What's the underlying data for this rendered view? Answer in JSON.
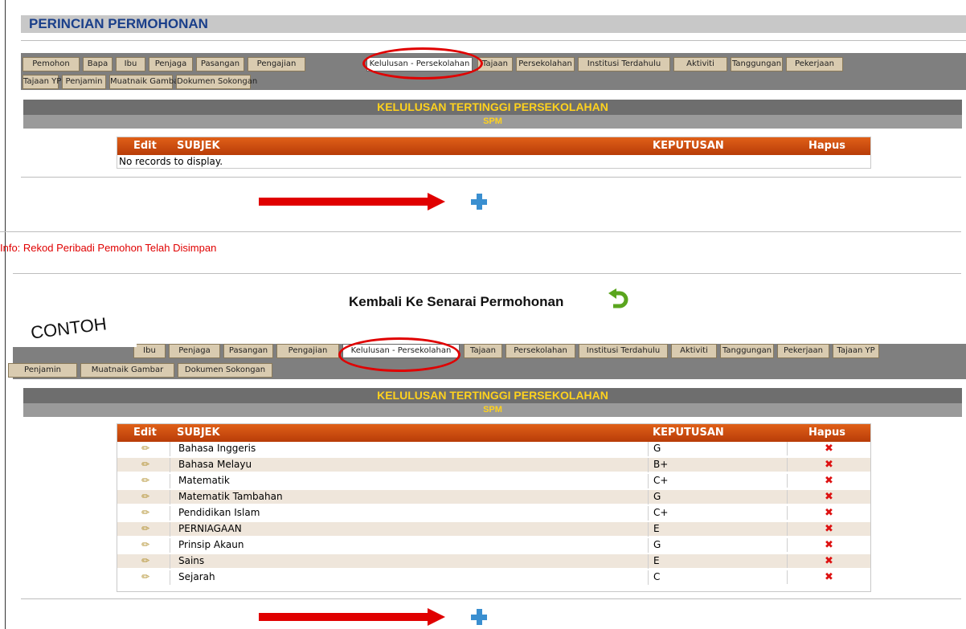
{
  "page_title": "PERINCIAN PERMOHONAN",
  "tabs_top_row1": [
    "Pemohon",
    "Bapa",
    "Ibu",
    "Penjaga",
    "Pasangan",
    "Pengajian",
    "Kelulusan - Persekolahan",
    "Tajaan",
    "Persekolahan",
    "Institusi Terdahulu",
    "Aktiviti",
    "Tanggungan",
    "Pekerjaan"
  ],
  "tabs_top_row2": [
    "Tajaan YP",
    "Penjamin",
    "Muatnaik Gambar",
    "Dokumen Sokongan"
  ],
  "tabs_bottom_row1": [
    "Ibu",
    "Penjaga",
    "Pasangan",
    "Pengajian",
    "Kelulusan - Persekolahan",
    "Tajaan",
    "Persekolahan",
    "Institusi Terdahulu",
    "Aktiviti",
    "Tanggungan",
    "Pekerjaan",
    "Tajaan YP"
  ],
  "tabs_bottom_row2": [
    "Penjamin",
    "Muatnaik Gambar",
    "Dokumen Sokongan"
  ],
  "section": {
    "title": "KELULUSAN TERTINGGI PERSEKOLAHAN",
    "subtitle": "SPM"
  },
  "grid_headers": {
    "edit": "Edit",
    "subject": "SUBJEK",
    "result": "KEPUTUSAN",
    "delete": "Hapus"
  },
  "empty_message": "No records to display.",
  "info_message": "Info: Rekod Peribadi Pemohon Telah Disimpan",
  "back_link": "Kembali Ke Senarai Permohonan",
  "example_label": "CONTOH",
  "records": [
    {
      "subject": "Bahasa Inggeris",
      "result": "G"
    },
    {
      "subject": "Bahasa Melayu",
      "result": "B+"
    },
    {
      "subject": "Matematik",
      "result": "C+"
    },
    {
      "subject": "Matematik Tambahan",
      "result": "G"
    },
    {
      "subject": "Pendidikan Islam",
      "result": "C+"
    },
    {
      "subject": "PERNIAGAAN",
      "result": "E"
    },
    {
      "subject": "Prinsip Akaun",
      "result": "G"
    },
    {
      "subject": "Sains",
      "result": "E"
    },
    {
      "subject": "Sejarah",
      "result": "C"
    }
  ],
  "icons": {
    "edit": "pencil-icon",
    "delete": "red-x-icon",
    "add": "blue-plus-icon",
    "back": "green-undo-arrow-icon"
  },
  "colors": {
    "title": "#1a3f8a",
    "header_text": "#ffd21e",
    "grid_header": "#c84a0c",
    "annotation": "#e00000",
    "tab": "#d9cbb0"
  }
}
